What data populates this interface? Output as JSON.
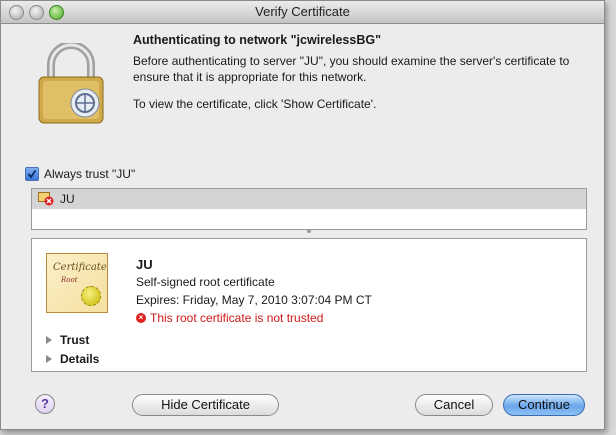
{
  "window": {
    "title": "Verify Certificate"
  },
  "dialog": {
    "heading": "Authenticating to network \"jcwirelessBG\"",
    "description": "Before authenticating to server \"JU\", you should examine the server's certificate to ensure that it is appropriate for this network.",
    "hint": "To view the certificate, click 'Show Certificate'."
  },
  "trust_checkbox": {
    "label": "Always trust \"JU\"",
    "checked": true
  },
  "cert_list": [
    {
      "name": "JU"
    }
  ],
  "cert_detail": {
    "image_title": "Certificate",
    "image_subtitle": "Root",
    "common_name": "JU",
    "kind": "Self-signed root certificate",
    "expires": "Expires: Friday, May 7, 2010 3:07:04 PM CT",
    "warning": "This root certificate is not trusted",
    "sections": [
      "Trust",
      "Details"
    ]
  },
  "buttons": {
    "help": "?",
    "hide_certificate": "Hide Certificate",
    "cancel": "Cancel",
    "continue": "Continue"
  },
  "colors": {
    "warning": "#d01818",
    "default_button": "#6aa6ea"
  }
}
